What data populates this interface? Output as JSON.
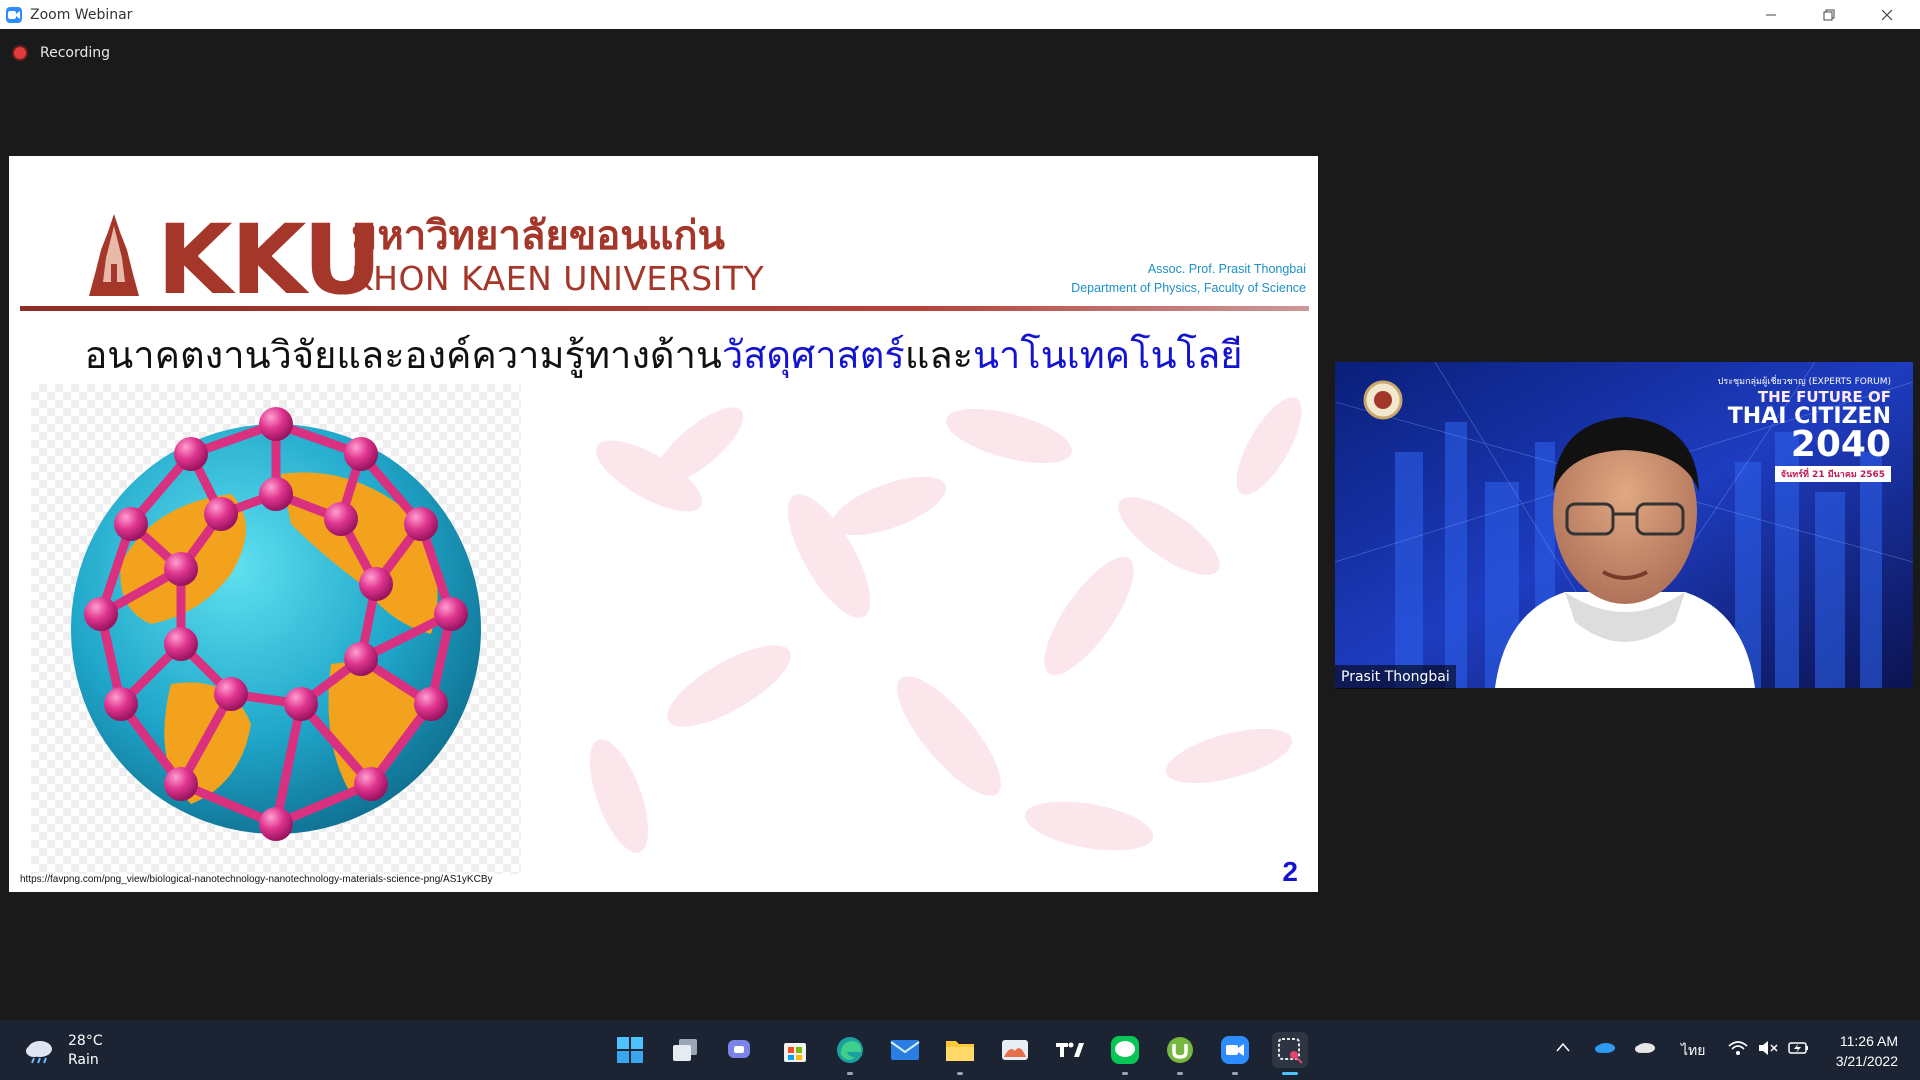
{
  "window": {
    "title": "Zoom Webinar",
    "controls": [
      "minimize",
      "restore",
      "close"
    ]
  },
  "recording": {
    "label": "Recording"
  },
  "slide": {
    "logo_text": "KKU",
    "university_thai": "มหาวิทยาลัยขอนแก่น",
    "university_en": "KHON KAEN UNIVERSITY",
    "presenter_name": "Assoc. Prof. Prasit Thongbai",
    "presenter_dept": "Department of Physics, Faculty of Science",
    "title_part1": "อนาคตงานวิจัยและองค์ความรู้ทางด้าน",
    "title_hl1": "วัสดุศาสตร์",
    "title_part2": "และ",
    "title_hl2": "นาโนเทคโนโลยี",
    "source_url": "https://favpng.com/png_view/biological-nanotechnology-nanotechnology-materials-science-png/AS1yKCBy",
    "page_number": "2",
    "accent_color": "#a5362a",
    "highlight_color": "#1414d0"
  },
  "video": {
    "participant_name": "Prasit Thongbai",
    "banner_line1": "ประชุมกลุ่มผู้เชี่ยวชาญ (EXPERTS FORUM)",
    "banner_line2": "THE FUTURE OF",
    "banner_line3": "THAI CITIZEN",
    "banner_year": "2040",
    "banner_date": "จันทร์ที่ 21 มีนาคม 2565"
  },
  "taskbar": {
    "weather_temp": "28°C",
    "weather_desc": "Rain",
    "apps": [
      "start",
      "task-view",
      "teams-chat",
      "microsoft-store",
      "edge",
      "mail",
      "file-explorer",
      "photos",
      "tradingview",
      "line",
      "utorrent",
      "zoom",
      "snipping-tool"
    ],
    "language": "ไทย",
    "time": "11:26 AM",
    "date": "3/21/2022"
  }
}
